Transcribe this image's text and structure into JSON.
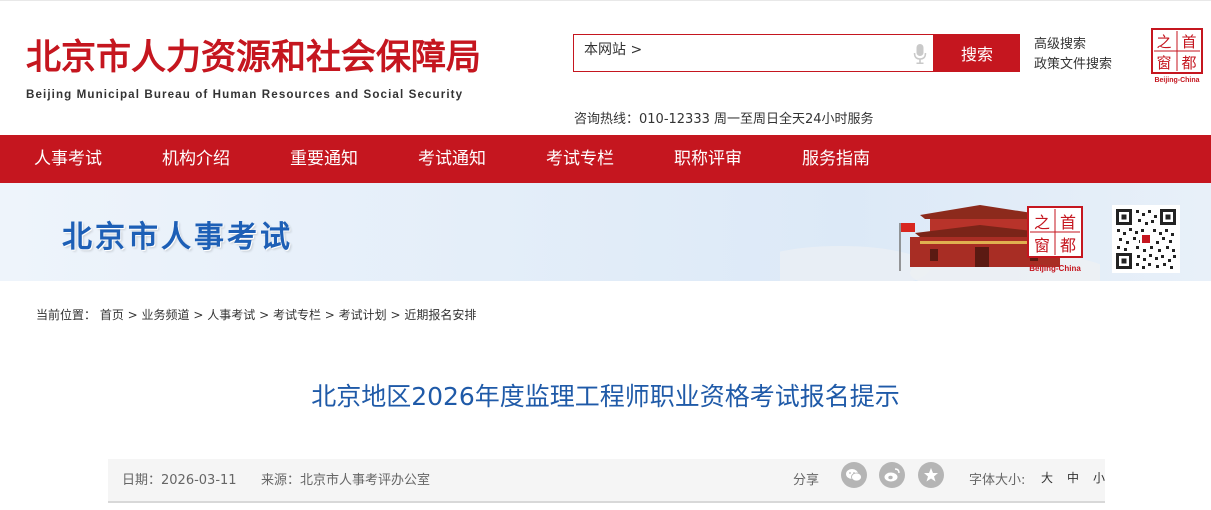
{
  "header": {
    "logo_cn": "北京市人力资源和社会保障局",
    "logo_en": "Beijing Municipal Bureau of Human Resources and Social Security",
    "search_scope": "本网站 >",
    "search_placeholder": "",
    "search_button": "搜索",
    "advanced_search": "高级搜索",
    "policy_search": "政策文件搜索",
    "hotline": "咨询热线：010-12333 周一至周日全天24小时服务",
    "seal_label": "Beijing-China",
    "seal_chars": [
      "之",
      "首",
      "窗",
      "都"
    ]
  },
  "nav": {
    "items": [
      "人事考试",
      "机构介绍",
      "重要通知",
      "考试通知",
      "考试专栏",
      "职称评审",
      "服务指南"
    ]
  },
  "banner": {
    "title": "北京市人事考试",
    "seal_label": "Beijing-China"
  },
  "breadcrumb": {
    "prefix": "当前位置：",
    "items": [
      "首页",
      "业务频道",
      "人事考试",
      "考试专栏",
      "考试计划",
      "近期报名安排"
    ],
    "separator": " > "
  },
  "article": {
    "title": "北京地区2026年度监理工程师职业资格考试报名提示",
    "date_label": "日期：2026-03-11",
    "source_label": "来源：北京市人事考评办公室",
    "share_label": "分享",
    "font_size_label": "字体大小:",
    "font_sizes": [
      "大",
      "中",
      "小"
    ]
  },
  "colors": {
    "brand_red": "#c5161f",
    "title_blue": "#1f5aa8",
    "banner_blue": "#1d5fb6"
  }
}
